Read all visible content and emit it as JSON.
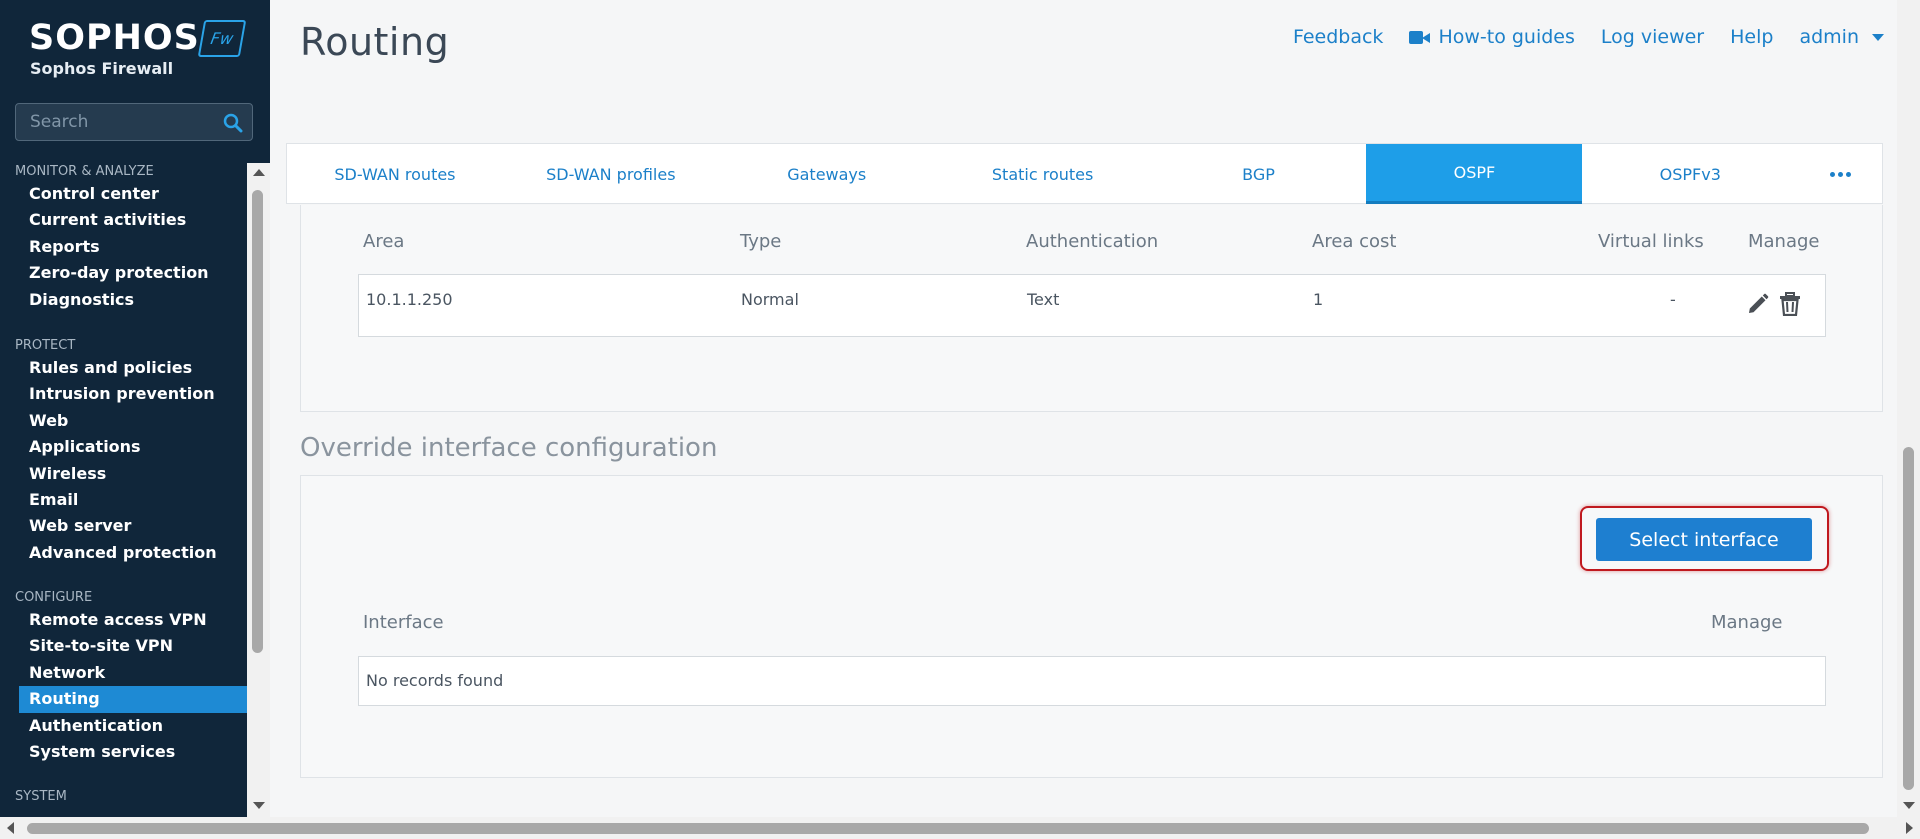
{
  "brand": {
    "logo_text": "SOPHOS",
    "badge": "Fw",
    "product": "Sophos Firewall"
  },
  "search": {
    "placeholder": "Search"
  },
  "sidebar": {
    "groups": [
      {
        "title": "MONITOR & ANALYZE",
        "items": [
          "Control center",
          "Current activities",
          "Reports",
          "Zero-day protection",
          "Diagnostics"
        ]
      },
      {
        "title": "PROTECT",
        "items": [
          "Rules and policies",
          "Intrusion prevention",
          "Web",
          "Applications",
          "Wireless",
          "Email",
          "Web server",
          "Advanced protection"
        ]
      },
      {
        "title": "CONFIGURE",
        "items": [
          "Remote access VPN",
          "Site-to-site VPN",
          "Network",
          "Routing",
          "Authentication",
          "System services"
        ]
      },
      {
        "title": "SYSTEM",
        "items": []
      }
    ],
    "active_item": "Routing"
  },
  "header": {
    "title": "Routing",
    "links": {
      "feedback": "Feedback",
      "howto": "How-to guides",
      "logviewer": "Log viewer",
      "help": "Help",
      "user": "admin"
    }
  },
  "tabs": [
    "SD-WAN routes",
    "SD-WAN profiles",
    "Gateways",
    "Static routes",
    "BGP",
    "OSPF",
    "OSPFv3"
  ],
  "active_tab": "OSPF",
  "area_table": {
    "headers": {
      "area": "Area",
      "type": "Type",
      "auth": "Authentication",
      "cost": "Area cost",
      "vlinks": "Virtual links",
      "manage": "Manage"
    },
    "rows": [
      {
        "area": "10.1.1.250",
        "type": "Normal",
        "auth": "Text",
        "cost": "1",
        "vlinks": "-"
      }
    ]
  },
  "override": {
    "title": "Override interface configuration",
    "button": "Select interface",
    "headers": {
      "interface": "Interface",
      "manage": "Manage"
    },
    "empty_text": "No records found"
  },
  "colors": {
    "sidebar_bg": "#10263a",
    "accent": "#1e9ee8",
    "link": "#1c80c9",
    "highlight": "#c0191f"
  }
}
